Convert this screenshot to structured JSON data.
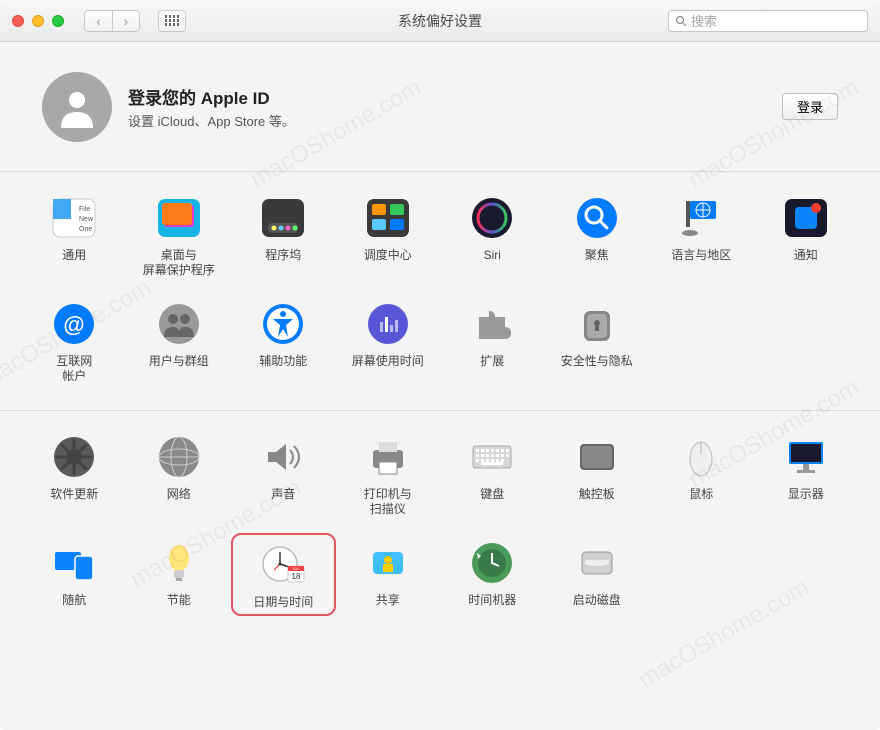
{
  "window": {
    "title": "系统偏好设置",
    "search_placeholder": "搜索"
  },
  "login": {
    "title": "登录您的 Apple ID",
    "subtitle": "设置 iCloud、App Store 等。",
    "button": "登录"
  },
  "sections": {
    "row1": [
      {
        "label": "通用",
        "icon": "general"
      },
      {
        "label": "桌面与\n屏幕保护程序",
        "icon": "desktop"
      },
      {
        "label": "程序坞",
        "icon": "dock"
      },
      {
        "label": "调度中心",
        "icon": "mission"
      },
      {
        "label": "Siri",
        "icon": "siri"
      },
      {
        "label": "聚焦",
        "icon": "spotlight"
      },
      {
        "label": "语言与地区",
        "icon": "language"
      },
      {
        "label": "通知",
        "icon": "notifications"
      }
    ],
    "row2": [
      {
        "label": "互联网\n帐户",
        "icon": "internet"
      },
      {
        "label": "用户与群组",
        "icon": "users"
      },
      {
        "label": "辅助功能",
        "icon": "accessibility"
      },
      {
        "label": "屏幕使用时间",
        "icon": "screentime"
      },
      {
        "label": "扩展",
        "icon": "extensions"
      },
      {
        "label": "安全性与隐私",
        "icon": "security"
      }
    ],
    "row3": [
      {
        "label": "软件更新",
        "icon": "update"
      },
      {
        "label": "网络",
        "icon": "network"
      },
      {
        "label": "声音",
        "icon": "sound"
      },
      {
        "label": "打印机与\n扫描仪",
        "icon": "printer"
      },
      {
        "label": "键盘",
        "icon": "keyboard"
      },
      {
        "label": "触控板",
        "icon": "trackpad"
      },
      {
        "label": "鼠标",
        "icon": "mouse"
      },
      {
        "label": "显示器",
        "icon": "displays"
      }
    ],
    "row4": [
      {
        "label": "随航",
        "icon": "sidecar"
      },
      {
        "label": "节能",
        "icon": "energy"
      },
      {
        "label": "日期与时间",
        "icon": "datetime"
      },
      {
        "label": "共享",
        "icon": "sharing"
      },
      {
        "label": "时间机器",
        "icon": "timemachine"
      },
      {
        "label": "启动磁盘",
        "icon": "startup"
      }
    ]
  },
  "highlighted": "datetime",
  "watermark": "macOShome.com"
}
